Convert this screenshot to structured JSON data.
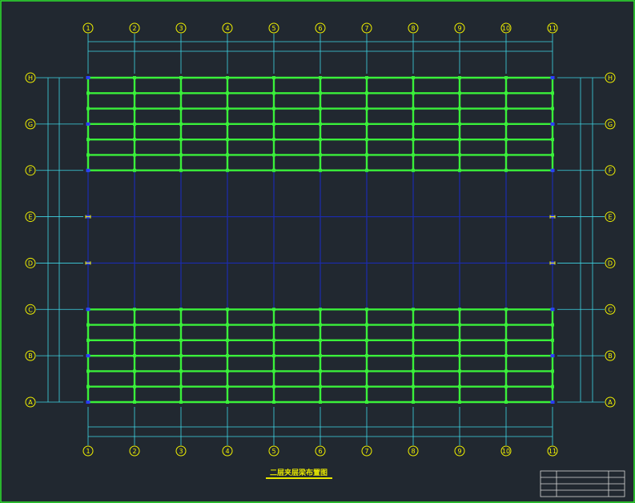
{
  "drawing": {
    "title": "二层夹层梁布置图",
    "column_axes": [
      "1",
      "2",
      "3",
      "4",
      "5",
      "6",
      "7",
      "8",
      "9",
      "10",
      "11"
    ],
    "row_axes": [
      "H",
      "G",
      "F",
      "E",
      "D",
      "C",
      "B",
      "A"
    ],
    "colors": {
      "background": "#212830",
      "border": "#2ee62e",
      "beam": "#3af03a",
      "grid_line": "#1b2bb0",
      "dimension_line": "#3fd6e6",
      "bubble": "#f2f200",
      "title_block": "#d8d8d8"
    }
  }
}
